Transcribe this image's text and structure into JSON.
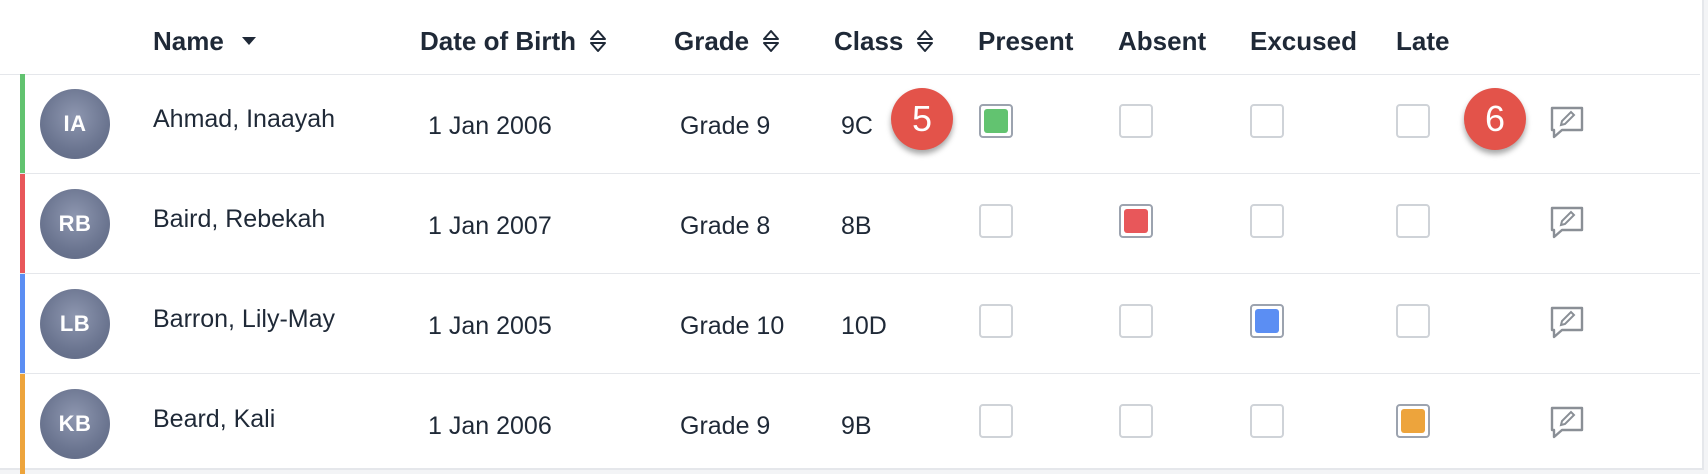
{
  "columns": {
    "name": "Name",
    "date_of_birth": "Date of Birth",
    "grade": "Grade",
    "class": "Class",
    "present": "Present",
    "absent": "Absent",
    "excused": "Excused",
    "late": "Late"
  },
  "colors": {
    "present": "#62c370",
    "absent": "#e8575a",
    "excused": "#5b8ef3",
    "late": "#eda43c"
  },
  "rows": [
    {
      "initials": "IA",
      "name": "Ahmad, Inaayah",
      "dob": "1 Jan 2006",
      "grade": "Grade 9",
      "class": "9C",
      "status": "present",
      "status_color": "#62c370"
    },
    {
      "initials": "RB",
      "name": "Baird, Rebekah",
      "dob": "1 Jan 2007",
      "grade": "Grade 8",
      "class": "8B",
      "status": "absent",
      "status_color": "#e8575a"
    },
    {
      "initials": "LB",
      "name": "Barron, Lily-May",
      "dob": "1 Jan 2005",
      "grade": "Grade 10",
      "class": "10D",
      "status": "excused",
      "status_color": "#5b8ef3"
    },
    {
      "initials": "KB",
      "name": "Beard, Kali",
      "dob": "1 Jan 2006",
      "grade": "Grade 9",
      "class": "9B",
      "status": "late",
      "status_color": "#eda43c"
    }
  ],
  "badges": {
    "first": "5",
    "second": "6"
  },
  "icons": {
    "sort": "sort-updown-icon",
    "caret": "caret-down-icon",
    "comment": "comment-edit-icon"
  }
}
